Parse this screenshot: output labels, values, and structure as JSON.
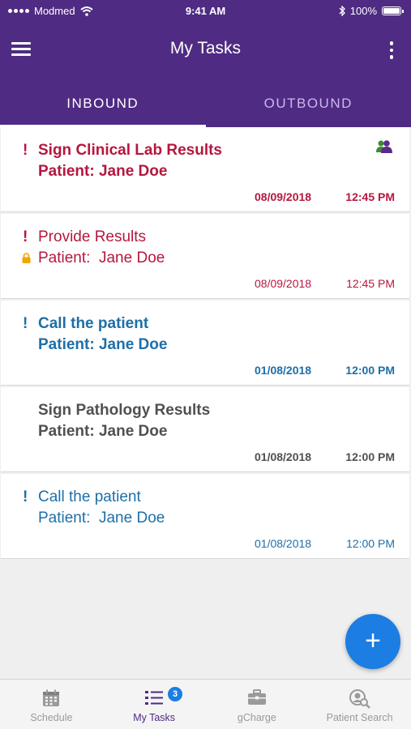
{
  "status_bar": {
    "carrier": "Modmed",
    "time": "9:41 AM",
    "battery": "100%"
  },
  "header": {
    "title": "My Tasks",
    "menu_icon": "hamburger-menu-icon",
    "more_icon": "more-vert-icon"
  },
  "tabs": [
    {
      "label": "INBOUND",
      "active": true
    },
    {
      "label": "OUTBOUND",
      "active": false
    }
  ],
  "tasks": [
    {
      "title": "Sign Clinical Lab Results",
      "patient_label": "Patient: Jane Doe",
      "date": "08/09/2018",
      "time": "12:45 PM",
      "priority": "!",
      "color": "#b5173f",
      "bold": true,
      "icon": "group-icon"
    },
    {
      "title": "Provide Results",
      "patient_label": "Patient:  Jane Doe",
      "date": "08/09/2018",
      "time": "12:45 PM",
      "priority": "!",
      "color": "#b5173f",
      "bold": false,
      "icon": "lock-icon"
    },
    {
      "title": "Call the patient",
      "patient_label": "Patient: Jane Doe",
      "date": "01/08/2018",
      "time": "12:00 PM",
      "priority": "!",
      "color": "#1d6fa8",
      "bold": true
    },
    {
      "title": "Sign Pathology Results",
      "patient_label": "Patient: Jane Doe",
      "date": "01/08/2018",
      "time": "12:00 PM",
      "priority": "",
      "color": "#505050",
      "bold": true
    },
    {
      "title": "Call the patient",
      "patient_label": "Patient:  Jane Doe",
      "date": "01/08/2018",
      "time": "12:00 PM",
      "priority": "!",
      "color": "#1d6fa8",
      "bold": false
    }
  ],
  "fab": {
    "label": "+"
  },
  "bottom_nav": [
    {
      "label": "Schedule",
      "icon": "calendar-icon",
      "active": false
    },
    {
      "label": "My Tasks",
      "icon": "task-list-icon",
      "active": true,
      "badge": "3"
    },
    {
      "label": "gCharge",
      "icon": "briefcase-icon",
      "active": false
    },
    {
      "label": "Patient Search",
      "icon": "patient-search-icon",
      "active": false
    }
  ],
  "colors": {
    "brand": "#4f2b83",
    "accent": "#1c7de2",
    "urgent": "#b5173f",
    "info": "#1d6fa8"
  }
}
